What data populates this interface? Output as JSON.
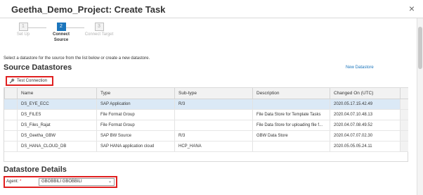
{
  "window": {
    "title": "Geetha_Demo_Project: Create Task",
    "close_symbol": "×"
  },
  "wizard": {
    "steps": [
      {
        "number": "1",
        "label_line1": "Set Up",
        "label_line2": "",
        "state": "done"
      },
      {
        "number": "2",
        "label_line1": "Connect",
        "label_line2": "Source",
        "state": "active"
      },
      {
        "number": "3",
        "label_line1": "Connect Target",
        "label_line2": "",
        "state": "upcoming"
      }
    ]
  },
  "instruction": "Select a datastore for the source from the list below or create a new datastore.",
  "source_datastores": {
    "heading": "Source Datastores",
    "new_datastore_link": "New Datastore",
    "test_connection_label": "Test Connection",
    "columns": [
      "Name",
      "Type",
      "Sub-type",
      "Description",
      "Changed On (UTC)"
    ],
    "rows": [
      {
        "name": "DS_EYE_ECC",
        "type": "SAP Application",
        "subtype": "R/3",
        "description": "",
        "changed": "2020.05.17.15.42.49",
        "selected": true
      },
      {
        "name": "DS_FILES",
        "type": "File Format Group",
        "subtype": "",
        "description": "File Data Store for Template Tasks",
        "changed": "2020.04.07.10.48.13",
        "selected": false
      },
      {
        "name": "DS_Files_Rajat",
        "type": "File Format Group",
        "subtype": "",
        "description": "File Data Store for uploading file f...",
        "changed": "2020.04.07.08.49.52",
        "selected": false
      },
      {
        "name": "DS_Geetha_GBW",
        "type": "SAP BW Source",
        "subtype": "R/3",
        "description": "GBW Data Store",
        "changed": "2020.04.07.07.02.30",
        "selected": false
      },
      {
        "name": "DS_HANA_CLOUD_DB",
        "type": "SAP HANA application cloud",
        "subtype": "HCP_HANA",
        "description": "",
        "changed": "2020.05.05.05.24.11",
        "selected": false
      }
    ]
  },
  "datastore_details": {
    "heading": "Datastore Details",
    "agent_label": "Agent",
    "required_mark": "*",
    "agent_value": "GBOBBILI GBOBBILI",
    "chevron": "⌄"
  },
  "colors": {
    "accent": "#1b75bc",
    "highlight_border": "#e02020",
    "selected_row": "#dbe9f6"
  }
}
